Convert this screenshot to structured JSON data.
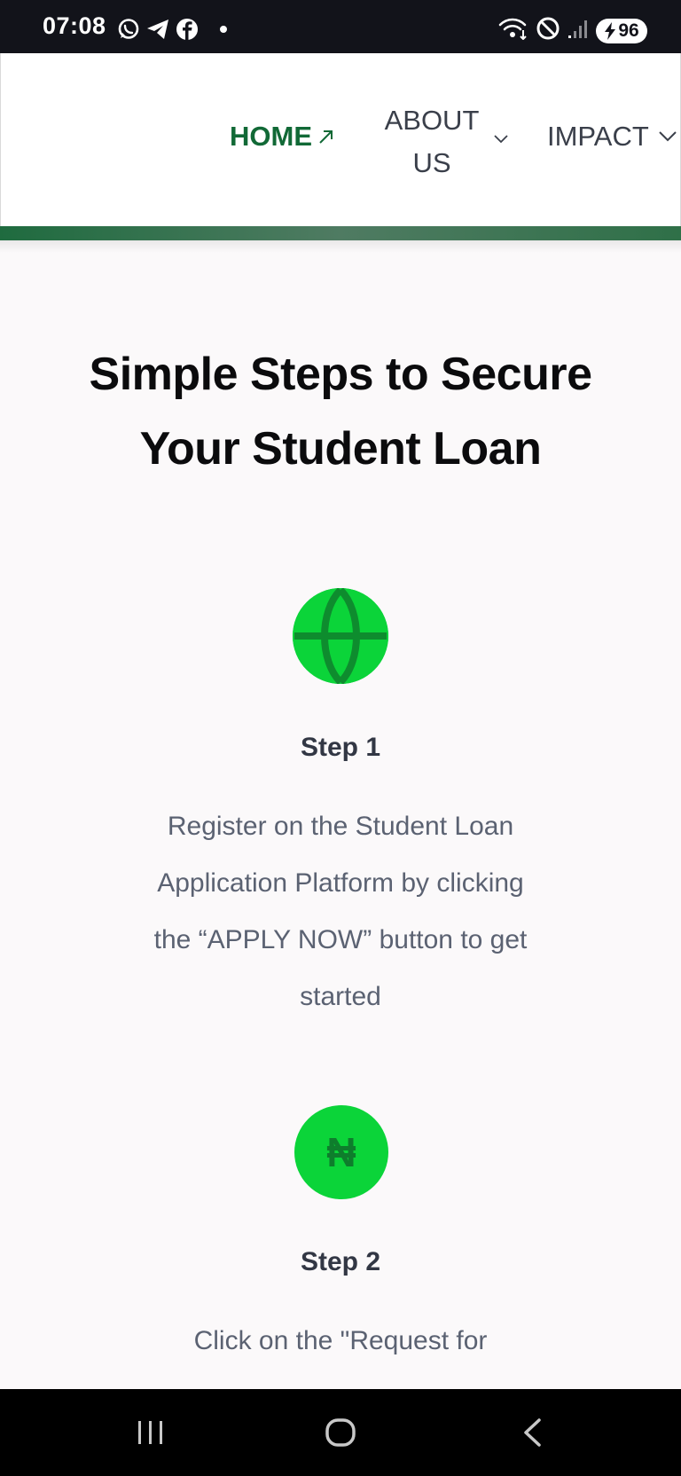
{
  "status_bar": {
    "time": "07:08",
    "battery": "96",
    "icons": [
      "whatsapp-icon",
      "telegram-icon",
      "facebook-icon",
      "notification-dot",
      "wifi-icon",
      "do-not-disturb-icon",
      "signal-icon",
      "battery-charging-icon"
    ]
  },
  "nav": {
    "home": "HOME",
    "about": "ABOUT US",
    "impact": "IMPACT",
    "active_color": "#116936",
    "accent_bar_color": "#2f7048"
  },
  "main": {
    "title": "Simple Steps to Secure Your Student Loan",
    "icon_color": "#0bd439",
    "steps": [
      {
        "icon": "globe-icon",
        "title": "Step 1",
        "description": "Register on the Student Loan Application Platform by clicking the “APPLY NOW” button to get started"
      },
      {
        "icon": "naira-icon",
        "icon_glyph": "₦",
        "title": "Step 2",
        "description": "Click on the \"Request for"
      }
    ]
  },
  "system_nav": {
    "buttons": [
      "recents-button",
      "home-button",
      "back-button"
    ]
  }
}
